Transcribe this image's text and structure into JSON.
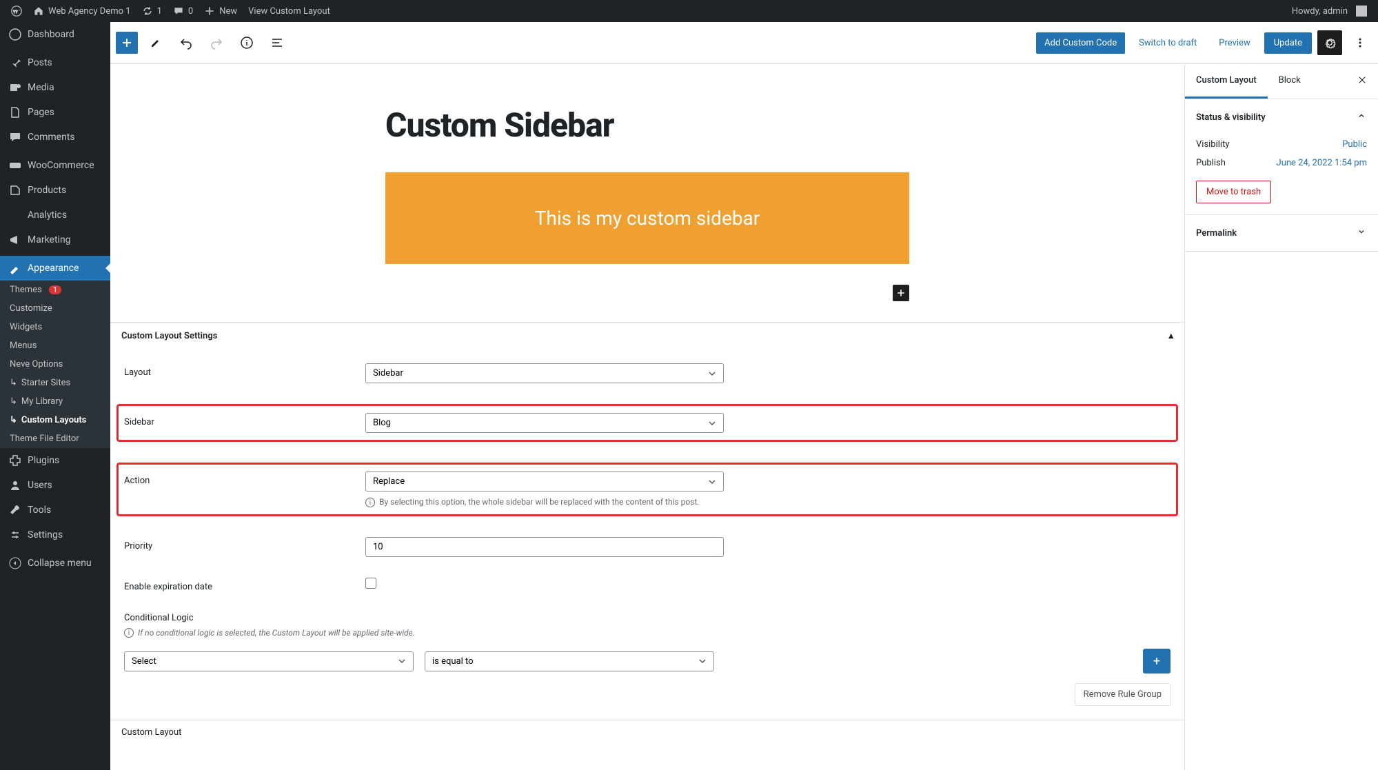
{
  "admin_bar": {
    "site_name": "Web Agency Demo 1",
    "updates_count": "1",
    "comments_count": "0",
    "new_label": "New",
    "view_label": "View Custom Layout",
    "howdy": "Howdy, admin"
  },
  "sidebar": {
    "items": [
      {
        "label": "Dashboard"
      },
      {
        "label": "Posts"
      },
      {
        "label": "Media"
      },
      {
        "label": "Pages"
      },
      {
        "label": "Comments"
      },
      {
        "label": "WooCommerce"
      },
      {
        "label": "Products"
      },
      {
        "label": "Analytics"
      },
      {
        "label": "Marketing"
      },
      {
        "label": "Appearance"
      },
      {
        "label": "Plugins"
      },
      {
        "label": "Users"
      },
      {
        "label": "Tools"
      },
      {
        "label": "Settings"
      },
      {
        "label": "Collapse menu"
      }
    ],
    "submenu": [
      {
        "label": "Themes",
        "badge": "1"
      },
      {
        "label": "Customize"
      },
      {
        "label": "Widgets"
      },
      {
        "label": "Menus"
      },
      {
        "label": "Neve Options"
      },
      {
        "label": "Starter Sites",
        "arrow": true
      },
      {
        "label": "My Library",
        "arrow": true
      },
      {
        "label": "Custom Layouts",
        "arrow": true,
        "current": true
      },
      {
        "label": "Theme File Editor"
      }
    ]
  },
  "header": {
    "add_code": "Add Custom Code",
    "switch_draft": "Switch to draft",
    "preview": "Preview",
    "update": "Update"
  },
  "canvas": {
    "title": "Custom Sidebar",
    "block_text": "This is my custom sidebar",
    "block_bg": "#f0a030"
  },
  "right_panel": {
    "tabs": {
      "layout": "Custom Layout",
      "block": "Block"
    },
    "status_title": "Status & visibility",
    "visibility_label": "Visibility",
    "visibility_value": "Public",
    "publish_label": "Publish",
    "publish_value": "June 24, 2022 1:54 pm",
    "trash": "Move to trash",
    "permalink": "Permalink"
  },
  "meta": {
    "title": "Custom Layout Settings",
    "layout": {
      "label": "Layout",
      "value": "Sidebar"
    },
    "sidebar": {
      "label": "Sidebar",
      "value": "Blog"
    },
    "action": {
      "label": "Action",
      "value": "Replace",
      "help": "By selecting this option, the whole sidebar will be replaced with the content of this post."
    },
    "priority": {
      "label": "Priority",
      "value": "10"
    },
    "expiration": {
      "label": "Enable expiration date"
    },
    "conditional": {
      "title": "Conditional Logic",
      "help": "If no conditional logic is selected, the Custom Layout will be applied site-wide.",
      "select_placeholder": "Select",
      "equal_placeholder": "is equal to",
      "remove_group": "Remove Rule Group"
    }
  },
  "breadcrumb": "Custom Layout"
}
